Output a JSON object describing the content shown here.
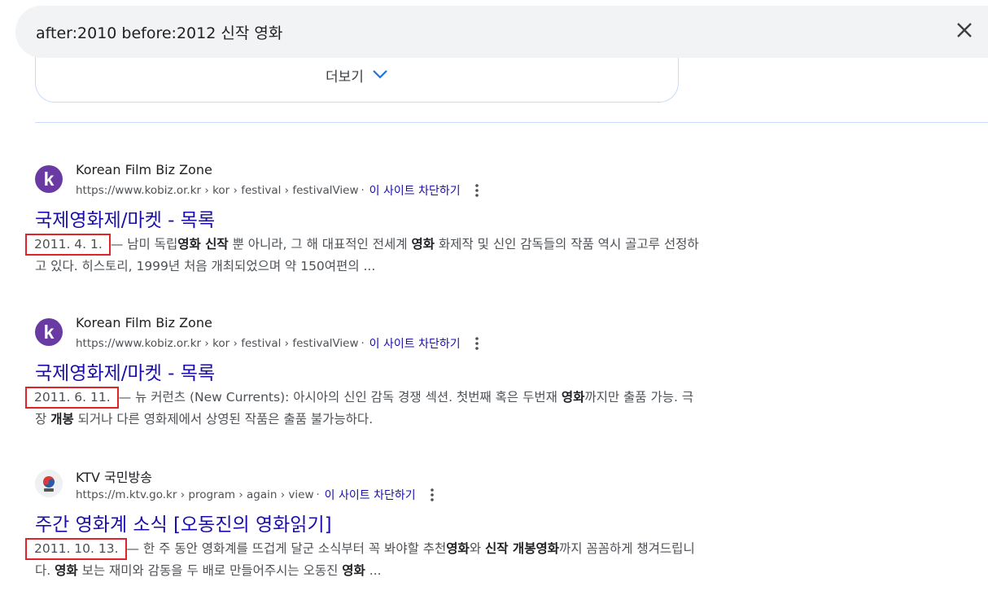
{
  "search": {
    "query": "after:2010 before:2012 신작 영화",
    "clear_icon": "close-icon"
  },
  "more": {
    "label": "더보기",
    "icon": "chevron-down-icon"
  },
  "results": [
    {
      "favicon": "kobiz-k-logo",
      "site_name": "Korean Film Biz Zone",
      "url": "https://www.kobiz.or.kr › kor › festival › festivalView",
      "separator": "·",
      "block_label": "이 사이트 차단하기",
      "title": "국제영화제/마켓 - 목록",
      "date": "2011. 4. 1.",
      "dash": "—",
      "snippet_parts": [
        {
          "t": " 남미 독립",
          "b": false
        },
        {
          "t": "영화 신작",
          "b": true
        },
        {
          "t": " 뿐 아니라, 그 해 대표적인 전세계 ",
          "b": false
        },
        {
          "t": "영화",
          "b": true
        },
        {
          "t": " 화제작 및 신인 감독들의 작품 역시 골고루 선정하고 있다. 히스토리, 1999년 처음 개최되었으며 약 150여편의 ...",
          "b": false
        }
      ]
    },
    {
      "favicon": "kobiz-k-logo",
      "site_name": "Korean Film Biz Zone",
      "url": "https://www.kobiz.or.kr › kor › festival › festivalView",
      "separator": "·",
      "block_label": "이 사이트 차단하기",
      "title": "국제영화제/마켓 - 목록",
      "date": "2011. 6. 11.",
      "dash": "—",
      "snippet_parts": [
        {
          "t": " 뉴 커런츠 (New Currents): 아시아의 신인 감독 경쟁 섹션. 첫번째 혹은 두번재 ",
          "b": false
        },
        {
          "t": "영화",
          "b": true
        },
        {
          "t": "까지만 출품 가능. 극장 ",
          "b": false
        },
        {
          "t": "개봉",
          "b": true
        },
        {
          "t": " 되거나 다른 영화제에서 상영된 작품은 출품 불가능하다.",
          "b": false
        }
      ]
    },
    {
      "favicon": "ktv-logo",
      "site_name": "KTV 국민방송",
      "url": "https://m.ktv.go.kr › program › again › view",
      "separator": "·",
      "block_label": "이 사이트 차단하기",
      "title": "주간 영화계 소식 [오동진의 영화읽기]",
      "date": "2011. 10. 13.",
      "dash": "—",
      "snippet_parts": [
        {
          "t": " 한 주 동안 영화계를 뜨겁게 달군 소식부터 꼭 봐야할 추천",
          "b": false
        },
        {
          "t": "영화",
          "b": true
        },
        {
          "t": "와 ",
          "b": false
        },
        {
          "t": "신작 개봉영화",
          "b": true
        },
        {
          "t": "까지 꼼꼼하게 챙겨드립니다. ",
          "b": false
        },
        {
          "t": "영화",
          "b": true
        },
        {
          "t": " 보는 재미와 감동을 두 배로 만들어주시는 오동진 ",
          "b": false
        },
        {
          "t": "영화",
          "b": true
        },
        {
          "t": " ...",
          "b": false
        }
      ]
    }
  ],
  "colors": {
    "link": "#1a0dab",
    "highlight_box": "#e0232b",
    "search_bg": "#f1f3f4"
  }
}
